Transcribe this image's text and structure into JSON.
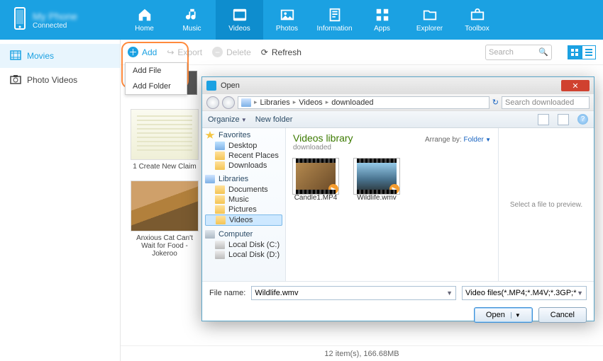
{
  "device": {
    "name": "My Phone",
    "status": "Connected"
  },
  "nav": [
    {
      "label": "Home"
    },
    {
      "label": "Music"
    },
    {
      "label": "Videos"
    },
    {
      "label": "Photos"
    },
    {
      "label": "Information"
    },
    {
      "label": "Apps"
    },
    {
      "label": "Explorer"
    },
    {
      "label": "Toolbox"
    }
  ],
  "sidebar": {
    "items": [
      {
        "label": "Movies"
      },
      {
        "label": "Photo Videos"
      }
    ]
  },
  "toolbar": {
    "add": "Add",
    "export": "Export",
    "delete": "Delete",
    "refresh": "Refresh",
    "search_placeholder": "Search",
    "add_menu": {
      "file": "Add File",
      "folder": "Add Folder"
    }
  },
  "thumbs": {
    "a": "1 Create New Claim",
    "b": "Anxious Cat Can't Wait for Food - Jokeroo"
  },
  "statusbar": "12 item(s), 166.68MB",
  "dialog": {
    "title": "Open",
    "crumbs": [
      "Libraries",
      "Videos",
      "downloaded"
    ],
    "search_placeholder": "Search downloaded",
    "organize": "Organize",
    "newfolder": "New folder",
    "tree": {
      "favorites": "Favorites",
      "desktop": "Desktop",
      "recent": "Recent Places",
      "downloads": "Downloads",
      "libraries": "Libraries",
      "documents": "Documents",
      "music": "Music",
      "pictures": "Pictures",
      "videos": "Videos",
      "computer": "Computer",
      "diskc": "Local Disk (C:)",
      "diskd": "Local Disk (D:)"
    },
    "files": {
      "head": "Videos library",
      "sub": "downloaded",
      "arrange_label": "Arrange by:",
      "arrange_value": "Folder",
      "items": [
        {
          "label": "Candle1.MP4"
        },
        {
          "label": "Wildlife.wmv"
        }
      ]
    },
    "preview": "Select a file to preview.",
    "filename_label": "File name:",
    "filename_value": "Wildlife.wmv",
    "filter": "Video files(*.MP4;*.M4V;*.3GP;*",
    "open": "Open",
    "cancel": "Cancel"
  }
}
